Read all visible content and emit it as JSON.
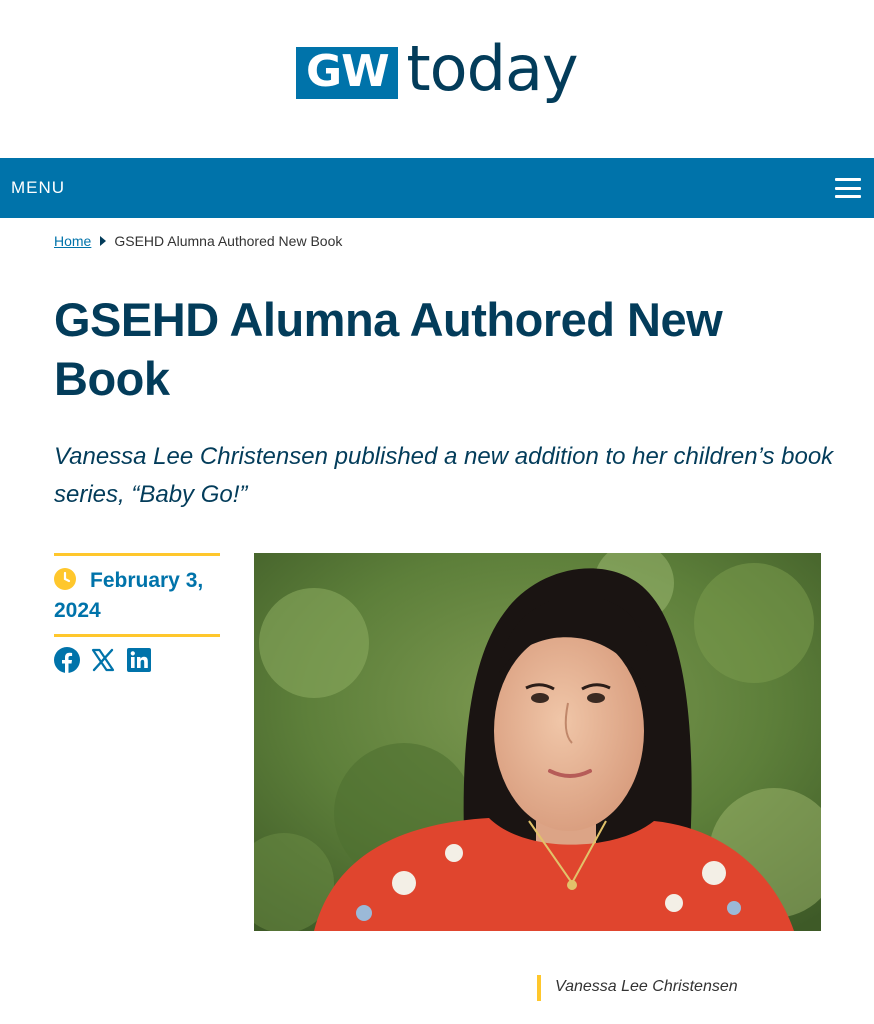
{
  "header": {
    "logo_box": "GW",
    "logo_word": "today"
  },
  "nav": {
    "menu_label": "MENU"
  },
  "breadcrumb": {
    "home": "Home",
    "current": "GSEHD Alumna Authored New Book"
  },
  "article": {
    "title": "GSEHD Alumna Authored New Book",
    "subtitle": "Vanessa Lee Christensen published a new addition to her children’s book series, “Baby Go!”",
    "date_line1": "February 3,",
    "date_line2": "2024",
    "share_icons": [
      "facebook-icon",
      "x-icon",
      "linkedin-icon"
    ],
    "caption": "Vanessa Lee Christensen"
  },
  "colors": {
    "brand_blue": "#0073aa",
    "navy": "#033c5a",
    "gold": "#ffc72c"
  }
}
